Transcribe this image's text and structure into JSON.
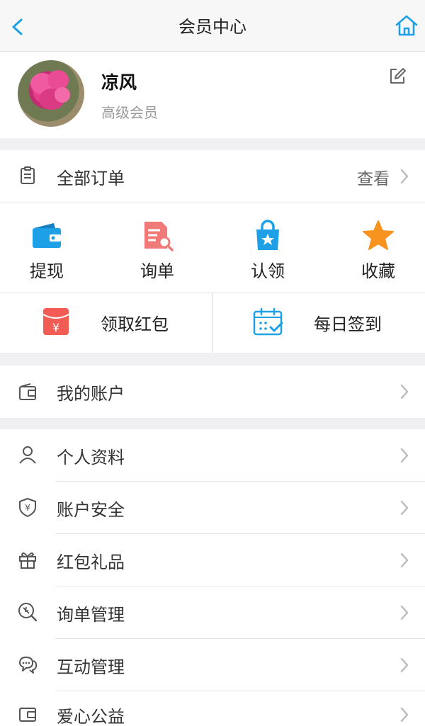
{
  "header": {
    "title": "会员中心"
  },
  "profile": {
    "name": "凉风",
    "level": "高级会员"
  },
  "orders": {
    "label": "全部订单",
    "action": "查看"
  },
  "quick_actions": [
    {
      "label": "提现",
      "icon": "wallet-icon",
      "color": "#1ea0e6"
    },
    {
      "label": "询单",
      "icon": "inquiry-icon",
      "color": "#f07a78"
    },
    {
      "label": "认领",
      "icon": "shopping-bag-icon",
      "color": "#1ea0e6"
    },
    {
      "label": "收藏",
      "icon": "star-icon",
      "color": "#f7931e"
    }
  ],
  "half_actions": [
    {
      "label": "领取红包",
      "icon": "red-envelope-icon",
      "color": "#f25c54"
    },
    {
      "label": "每日签到",
      "icon": "calendar-check-icon",
      "color": "#1ea0e6"
    }
  ],
  "account": {
    "label": "我的账户"
  },
  "menu": [
    {
      "label": "个人资料",
      "icon": "user-icon"
    },
    {
      "label": "账户安全",
      "icon": "shield-yen-icon"
    },
    {
      "label": "红包礼品",
      "icon": "gift-icon"
    },
    {
      "label": "询单管理",
      "icon": "inquiry-search-icon"
    },
    {
      "label": "互动管理",
      "icon": "chat-icon"
    },
    {
      "label": "爱心公益",
      "icon": "charity-wallet-icon"
    }
  ]
}
